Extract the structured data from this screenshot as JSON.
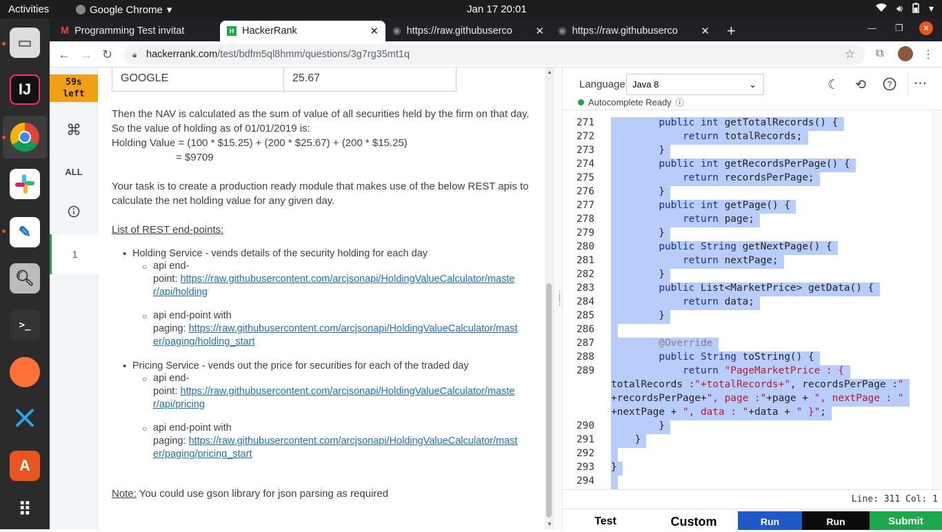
{
  "topbar": {
    "activities": "Activities",
    "app": "Google Chrome",
    "clock": "Jan 17  20:01"
  },
  "dock": {
    "items": [
      "files-icon",
      "intellij-icon",
      "chrome-icon",
      "slack-icon",
      "text-editor-icon",
      "image-viewer-icon",
      "terminal-icon",
      "firefox-icon",
      "vscode-icon",
      "software-center-icon",
      "app-grid-icon"
    ]
  },
  "browser": {
    "tabs": [
      {
        "title": "Programming Test invitat",
        "icon": "gmail-icon"
      },
      {
        "title": "HackerRank",
        "icon": "hackerrank-icon"
      },
      {
        "title": "https://raw.githubuserco",
        "icon": "globe-icon"
      },
      {
        "title": "https://raw.githubuserco",
        "icon": "globe-icon"
      }
    ],
    "new_tab": "+",
    "url_host": "hackerrank.com",
    "url_path": "/test/bdfm5ql8hmm/questions/3g7rg35mt1q"
  },
  "hr_nav": {
    "timer_line1": "59s",
    "timer_line2": "left",
    "all_label": "ALL",
    "question_number": "1"
  },
  "problem": {
    "table_row": {
      "name": "GOOGLE",
      "value": "25.67"
    },
    "para1": "Then the NAV is calculated as the sum of value of all securities held by the firm on that day. So the value of holding as of 01/01/2019 is:",
    "formula1": "Holding Value = (100 * $15.25) + (200 * $25.67) + (200 * $15.25)",
    "formula2": "= $9709",
    "para2": "Your task is to create a production ready module that makes use of the below REST apis to calculate the net holding value for any given day.",
    "list_heading": "List of REST end-points:",
    "services": [
      {
        "title": "Holding Service - vends details of the security holding for each day",
        "endpoints": [
          {
            "label_1": "api end-",
            "label_2": "point: ",
            "url": "https://raw.githubusercontent.com/arcjsonapi/HoldingValueCalculator/master/api/holding",
            "url_line1": "https://raw.githubusercontent.com/arcjsonapi/HoldingValueCalculator/maste",
            "url_line2": "r/api/holding"
          },
          {
            "label_1": "api end-point with",
            "label_2": "paging: ",
            "url": "https://raw.githubusercontent.com/arcjsonapi/HoldingValueCalculator/master/paging/holding_start",
            "url_line1": "https://raw.githubusercontent.com/arcjsonapi/HoldingValueCalculator/mast",
            "url_line2": "er/paging/holding_start"
          }
        ]
      },
      {
        "title": "Pricing Service - vends out the price for securities for each of the traded day",
        "endpoints": [
          {
            "label_1": "api end-",
            "label_2": "point: ",
            "url": "https://raw.githubusercontent.com/arcjsonapi/HoldingValueCalculator/master/api/pricing",
            "url_line1": "https://raw.githubusercontent.com/arcjsonapi/HoldingValueCalculator/maste",
            "url_line2": "r/api/pricing"
          },
          {
            "label_1": "api end-point with",
            "label_2": "paging: ",
            "url": "https://raw.githubusercontent.com/arcjsonapi/HoldingValueCalculator/master/paging/pricing_start",
            "url_line1": "https://raw.githubusercontent.com/arcjsonapi/HoldingValueCalculator/mast",
            "url_line2": "er/paging/pricing_start"
          }
        ]
      }
    ],
    "note_label": "Note:",
    "note_text": " You could use gson library for json parsing as required"
  },
  "editor": {
    "language_label": "Language",
    "language_value": "Java 8",
    "status": "Autocomplete Ready",
    "lines": [
      {
        "n": "271",
        "t": "        public int getTotalRecords() {"
      },
      {
        "n": "272",
        "t": "            return totalRecords;"
      },
      {
        "n": "273",
        "t": "        }"
      },
      {
        "n": "274",
        "t": "        public int getRecordsPerPage() {"
      },
      {
        "n": "275",
        "t": "            return recordsPerPage;"
      },
      {
        "n": "276",
        "t": "        }"
      },
      {
        "n": "277",
        "t": "        public int getPage() {"
      },
      {
        "n": "278",
        "t": "            return page;"
      },
      {
        "n": "279",
        "t": "        }"
      },
      {
        "n": "280",
        "t": "        public String getNextPage() {"
      },
      {
        "n": "281",
        "t": "            return nextPage;"
      },
      {
        "n": "282",
        "t": "        }"
      },
      {
        "n": "283",
        "t": "        public List<MarketPrice> getData() {"
      },
      {
        "n": "284",
        "t": "            return data;"
      },
      {
        "n": "285",
        "t": "        }"
      },
      {
        "n": "286",
        "t": ""
      },
      {
        "n": "287",
        "t": "        @Override"
      },
      {
        "n": "288",
        "t": "        public String toString() {"
      },
      {
        "n": "289",
        "t": "            return \"PageMarketPrice : {"
      },
      {
        "n": "",
        "t": "totalRecords :\"+totalRecords+\", recordsPerPage :\""
      },
      {
        "n": "",
        "t": "+recordsPerPage+\", page :\"+page + \", nextPage : \""
      },
      {
        "n": "",
        "t": "+nextPage + \", data : \"+data + \" }\";"
      },
      {
        "n": "290",
        "t": "        }"
      },
      {
        "n": "291",
        "t": "    }"
      },
      {
        "n": "292",
        "t": ""
      },
      {
        "n": "293",
        "t": "}"
      },
      {
        "n": "294",
        "t": ""
      }
    ],
    "cursor_pos": "Line: 311 Col: 1",
    "buttons": {
      "test": "Test",
      "custom": "Custom",
      "run1": "Run",
      "run2": "Run",
      "submit": "Submit"
    },
    "colors": {
      "selection": "#b9cdfb",
      "run_blue": "#1f58c7",
      "submit_green": "#1ba94c"
    }
  }
}
